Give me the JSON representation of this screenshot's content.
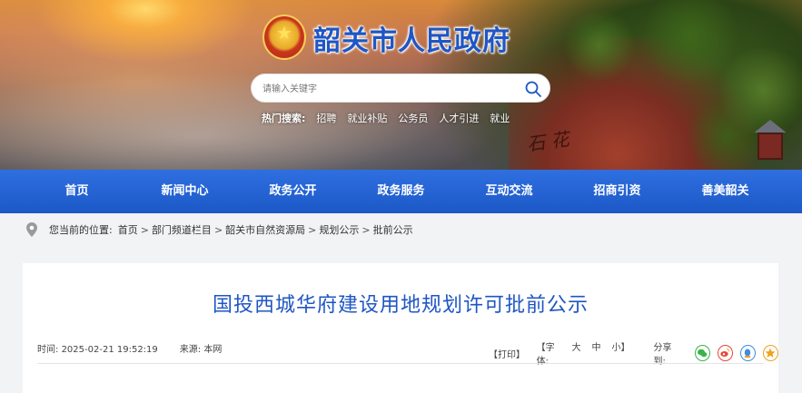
{
  "header": {
    "site_title": "韶关市人民政府",
    "search_placeholder": "请输入关键字",
    "hot_label": "热门搜索:",
    "hot_keywords": [
      "招聘",
      "就业补贴",
      "公务员",
      "人才引进",
      "就业"
    ],
    "carved_text": "石 花"
  },
  "nav": {
    "items": [
      "首页",
      "新闻中心",
      "政务公开",
      "政务服务",
      "互动交流",
      "招商引资",
      "善美韶关"
    ]
  },
  "breadcrumb": {
    "prefix": "您当前的位置:",
    "items": [
      "首页",
      "部门频道栏目",
      "韶关市自然资源局",
      "规划公示",
      "批前公示"
    ],
    "separator": ">"
  },
  "article": {
    "title": "国投西城华府建设用地规划许可批前公示",
    "time_label": "时间:",
    "time_value": "2025-02-21 19:52:19",
    "source_label": "来源:",
    "source_value": "本网",
    "print_label": "【打印】",
    "font_label": "【字体:",
    "font_large": "大",
    "font_medium": "中",
    "font_small": "小】",
    "share_label": "分享到:"
  },
  "colors": {
    "brand_blue": "#1f56c4",
    "nav_blue": "#2563d6",
    "wechat": "#3bb34a",
    "weibo": "#e8463a",
    "qq": "#3a8de0",
    "qzone": "#f0a21c"
  }
}
